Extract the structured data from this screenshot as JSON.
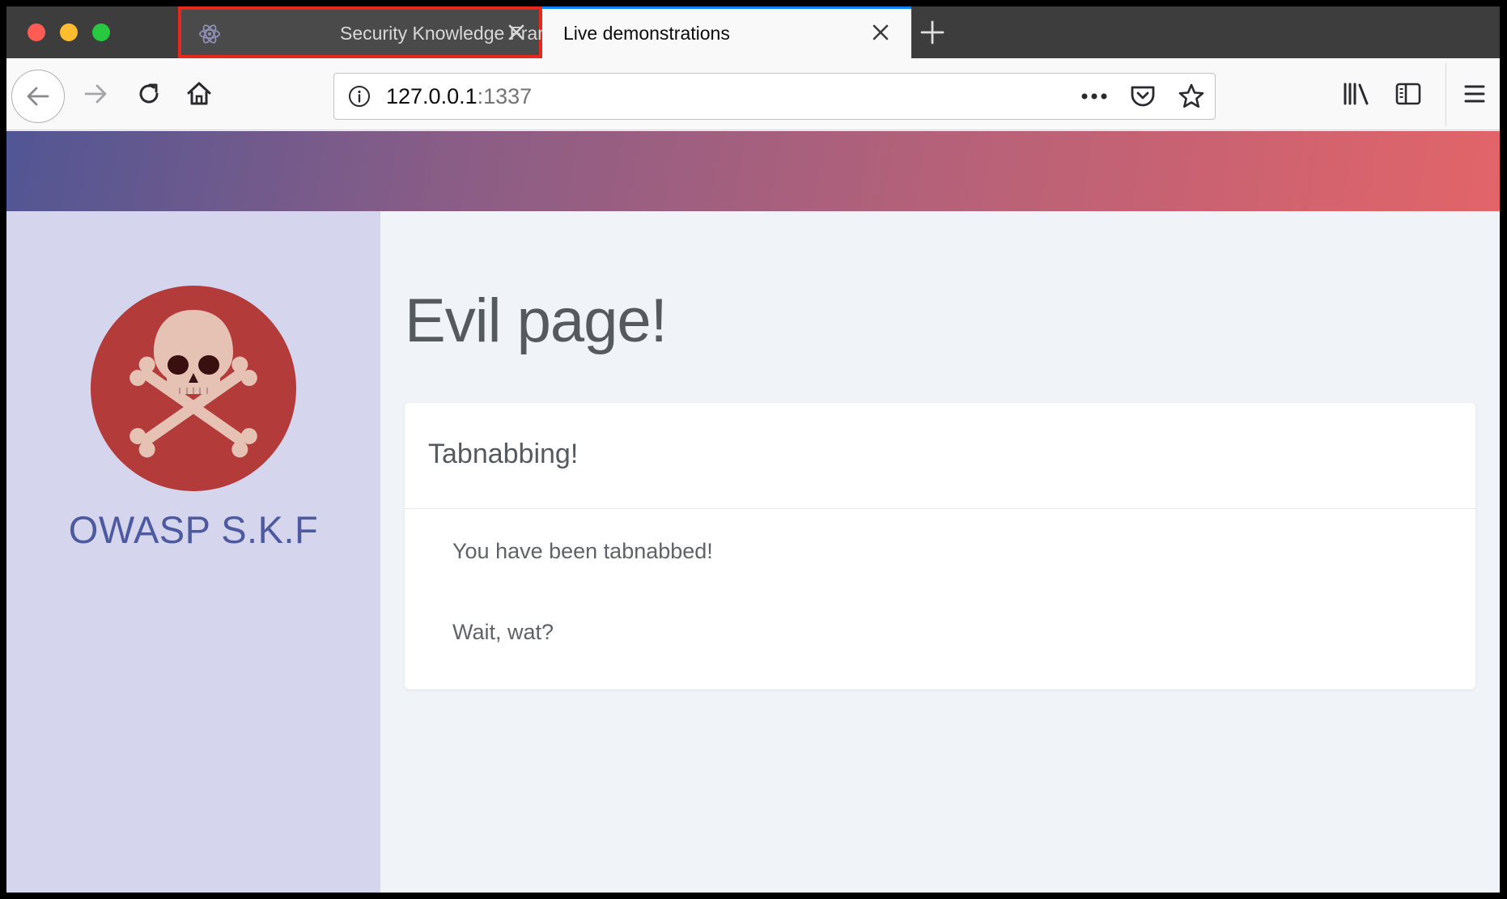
{
  "browser": {
    "tabs": [
      {
        "label": "Security Knowledge Framework",
        "active": false,
        "highlighted": true
      },
      {
        "label": "Live demonstrations",
        "active": true
      }
    ],
    "address": {
      "host": "127.0.0.1",
      "port": ":1337"
    },
    "icons": {
      "tab_favicon": "atom-icon",
      "close": "close-icon",
      "new_tab": "plus-icon",
      "back": "arrow-left-icon",
      "forward": "arrow-right-icon",
      "reload": "reload-icon",
      "home": "home-icon",
      "info": "info-icon",
      "page_actions": "more-icon",
      "pocket": "pocket-icon",
      "bookmark": "star-icon",
      "library": "library-icon",
      "sidebar": "sidebar-icon",
      "menu": "hamburger-icon"
    },
    "colors": {
      "highlight_outline": "#e8281c",
      "tab_strip": "#3d3d3d"
    }
  },
  "page": {
    "brand": "OWASP S.K.F",
    "logo": "skull-crossbones-icon",
    "title": "Evil page!",
    "card": {
      "title": "Tabnabbing!",
      "lines": [
        "You have been tabnabbed!",
        "Wait, wat?"
      ]
    },
    "colors": {
      "banner_start": "#515694",
      "banner_end": "#e26469",
      "side_panel": "#d5d5ee",
      "brand_text": "#4e5aa0",
      "logo_circle": "#b33b3a"
    }
  }
}
